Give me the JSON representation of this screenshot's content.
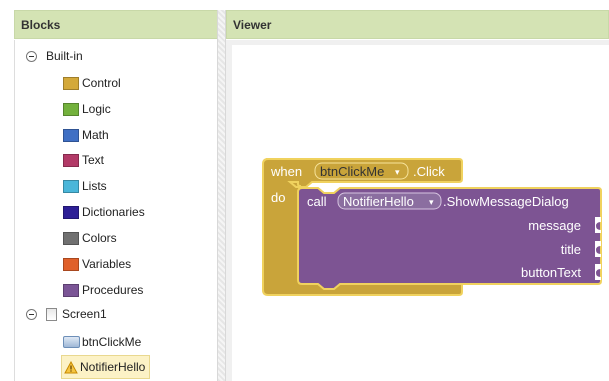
{
  "panels": {
    "blocks_title": "Blocks",
    "viewer_title": "Viewer"
  },
  "tree": {
    "builtin_label": "Built-in",
    "builtin_items": [
      {
        "label": "Control",
        "color": "#d4a93a"
      },
      {
        "label": "Logic",
        "color": "#73b13c"
      },
      {
        "label": "Math",
        "color": "#3f6fc4"
      },
      {
        "label": "Text",
        "color": "#b23a67"
      },
      {
        "label": "Lists",
        "color": "#4ab6d9"
      },
      {
        "label": "Dictionaries",
        "color": "#2d1f96"
      },
      {
        "label": "Colors",
        "color": "#707070"
      },
      {
        "label": "Variables",
        "color": "#e0602a"
      },
      {
        "label": "Procedures",
        "color": "#7b5596"
      }
    ],
    "screen_label": "Screen1",
    "components": [
      {
        "label": "btnClickMe",
        "icon": "button-icon"
      },
      {
        "label": "NotifierHello",
        "icon": "warning-icon",
        "selected": true
      }
    ]
  },
  "blocks": {
    "event": {
      "when": "when",
      "component": "btnClickMe",
      "event_name": ".Click",
      "do": "do",
      "color": "#c9a43a"
    },
    "call": {
      "call": "call",
      "component": "NotifierHello",
      "method": ".ShowMessageDialog",
      "params": [
        "message",
        "title",
        "buttonText"
      ],
      "color": "#7d5493"
    }
  }
}
